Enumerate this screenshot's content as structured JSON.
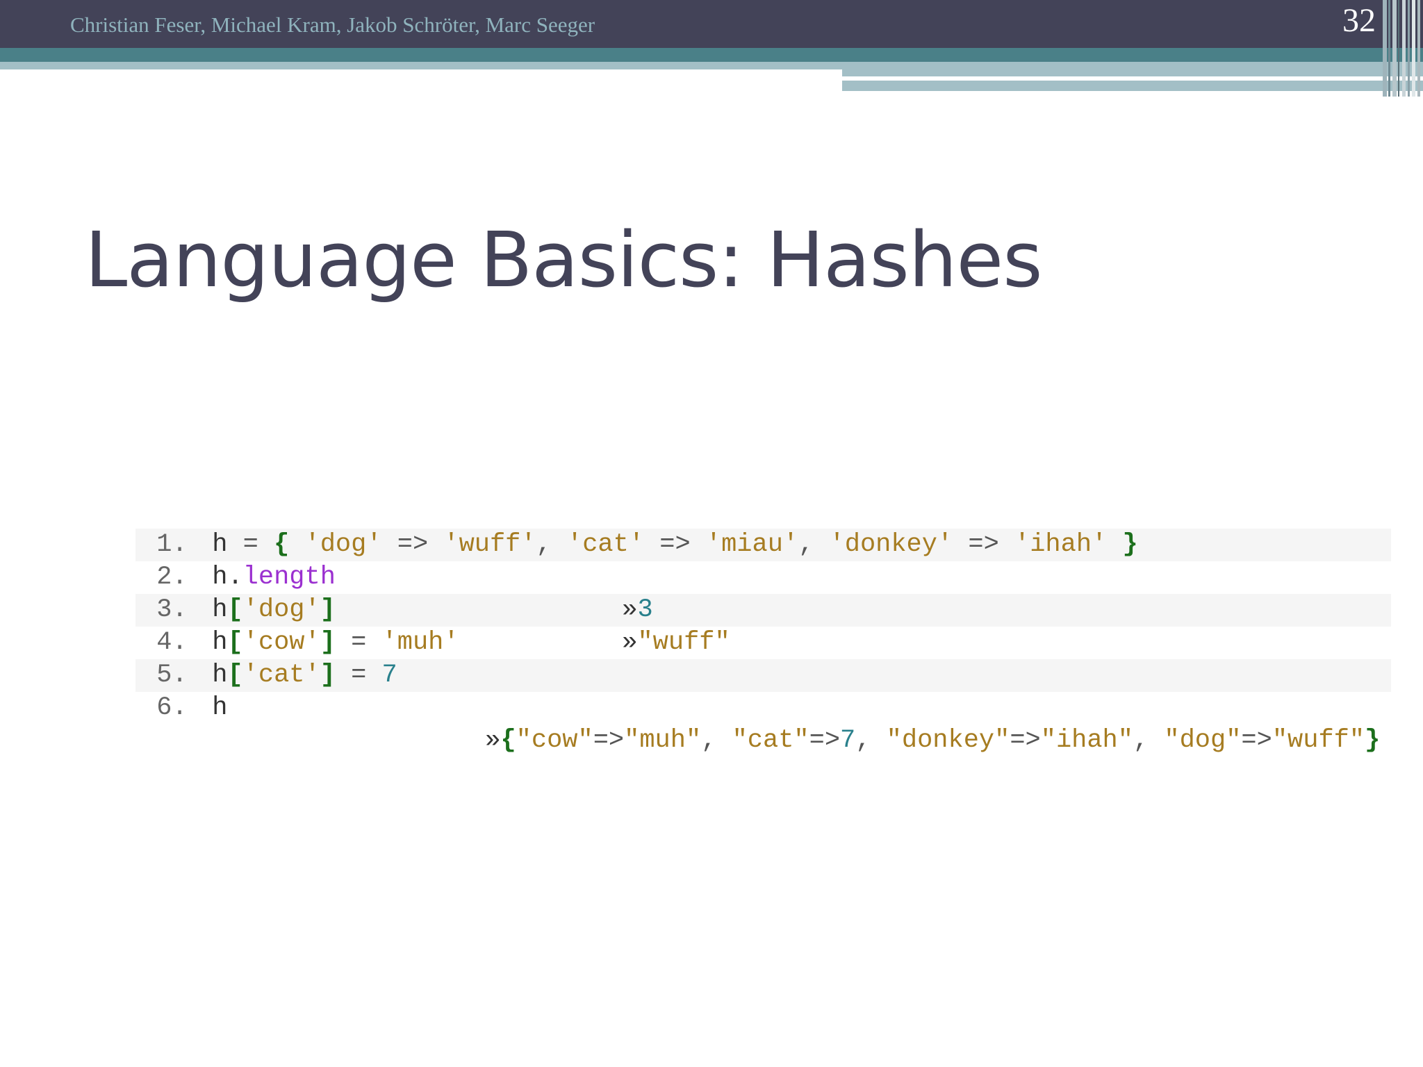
{
  "header": {
    "authors": "Christian Feser, Michael Kram, Jakob Schröter, Marc Seeger",
    "slide_number": "32"
  },
  "title": "Language Basics: Hashes",
  "code": {
    "lines": [
      {
        "number": "1.",
        "h": "h",
        "eq": " = ",
        "open": "{",
        "k1": " 'dog'",
        "a1": " => ",
        "v1": "'wuff'",
        "c1": ", ",
        "k2": "'cat'",
        "a2": " => ",
        "v2": "'miau'",
        "c2": ", ",
        "k3": "'donkey'",
        "a3": " => ",
        "v3": "'ihah'",
        "close": " }"
      },
      {
        "number": "2.",
        "h": "h",
        "dot": ".",
        "method": "length",
        "arrow": "»",
        "result": "3"
      },
      {
        "number": "3.",
        "h": "h",
        "lb": "[",
        "key": "'dog'",
        "rb": "]",
        "arrow": "»",
        "result": "\"wuff\""
      },
      {
        "number": "4.",
        "h": "h",
        "lb": "[",
        "key": "'cow'",
        "rb": "]",
        "eq": " = ",
        "value": "'muh'"
      },
      {
        "number": "5.",
        "h": "h",
        "lb": "[",
        "key": "'cat'",
        "rb": "]",
        "eq": " = ",
        "value": "7"
      },
      {
        "number": "6.",
        "h": "h",
        "arrow": "»",
        "open": "{",
        "r1k": "\"cow\"",
        "r1a": "=>",
        "r1v": "\"muh\"",
        "r1c": ", ",
        "r2k": "\"cat\"",
        "r2a": "=>",
        "r2v": "7",
        "r2c": ", ",
        "r3k": "\"donkey\"",
        "r3a": "=>",
        "r3v": "\"ihah\"",
        "r3c": ", ",
        "r4k": "\"dog\"",
        "r4a": "=>",
        "r4v": "\"wuff\"",
        "close": "}"
      }
    ]
  },
  "colors": {
    "header": "#434358",
    "teal": "#4a8088",
    "light_teal": "#a3bfc6",
    "title": "#434358"
  }
}
